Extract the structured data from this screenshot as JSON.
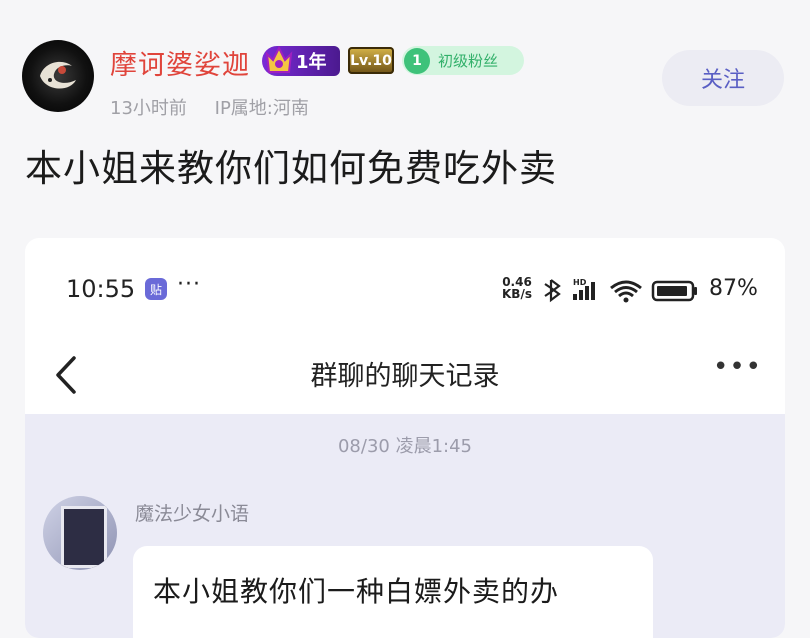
{
  "post": {
    "username": "摩诃婆娑迦",
    "badge_year": "1年",
    "badge_level": "Lv.10",
    "fan_level": "1",
    "fan_label": "初级粉丝",
    "time_ago": "13小时前",
    "ip_location": "IP属地:河南",
    "follow_label": "关注",
    "title": "本小姐来教你们如何免费吃外卖"
  },
  "screenshot": {
    "status_bar": {
      "time": "10:55",
      "app_icon_text": "贴",
      "more": "···",
      "speed_value": "0.46",
      "speed_unit": "KB/s",
      "battery": "87%"
    },
    "nav": {
      "title": "群聊的聊天记录",
      "more": "•••"
    },
    "chat": {
      "timestamp": "08/30 凌晨1:45",
      "sender": "魔法少女小语",
      "message": "本小姐教你们一种白嫖外卖的办"
    }
  },
  "colors": {
    "username": "#e0443b",
    "follow_text": "#5a5fc4",
    "chat_bg": "#ebebf6",
    "fan_badge": "#3ec27a"
  }
}
